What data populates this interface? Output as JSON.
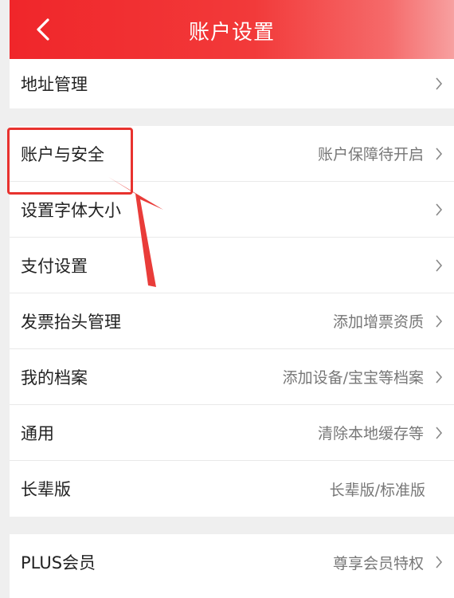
{
  "header": {
    "title": "账户设置",
    "back_icon": "chevron-left-icon"
  },
  "groups": [
    {
      "items": [
        {
          "label": "地址管理",
          "value": ""
        }
      ]
    },
    {
      "items": [
        {
          "label": "账户与安全",
          "value": "账户保障待开启"
        },
        {
          "label": "设置字体大小",
          "value": ""
        },
        {
          "label": "支付设置",
          "value": ""
        },
        {
          "label": "发票抬头管理",
          "value": "添加增票资质"
        },
        {
          "label": "我的档案",
          "value": "添加设备/宝宝等档案"
        },
        {
          "label": "通用",
          "value": "清除本地缓存等"
        },
        {
          "label": "长辈版",
          "value": "长辈版/标准版"
        }
      ]
    },
    {
      "items": [
        {
          "label": "PLUS会员",
          "value": "尊享会员特权"
        }
      ]
    }
  ],
  "annotation": {
    "highlight_color": "#e8322e",
    "type": "red-box-and-arrow"
  },
  "colors": {
    "header": "#f0262a",
    "background": "#efefef"
  }
}
